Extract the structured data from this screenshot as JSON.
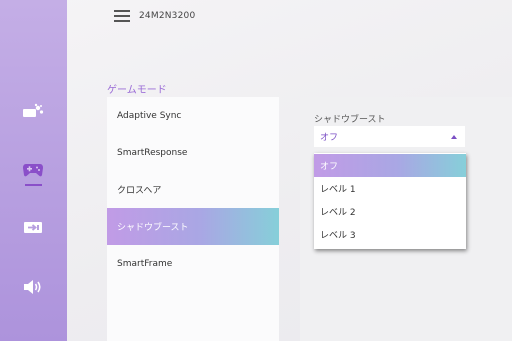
{
  "header": {
    "model_name": "24M2N3200"
  },
  "sidebar": {
    "icons": [
      {
        "name": "picture-icon"
      },
      {
        "name": "game-mode-icon",
        "active": true
      },
      {
        "name": "input-source-icon"
      },
      {
        "name": "volume-icon"
      }
    ]
  },
  "section": {
    "title": "ゲームモード"
  },
  "menu": {
    "items": [
      {
        "label": "Adaptive Sync",
        "selected": false
      },
      {
        "label": "SmartResponse",
        "selected": false
      },
      {
        "label": "クロスヘア",
        "selected": false
      },
      {
        "label": "シャドウブースト",
        "selected": true
      },
      {
        "label": "SmartFrame",
        "selected": false
      }
    ]
  },
  "shadow_boost": {
    "label": "シャドウブースト",
    "current_value": "オフ",
    "options": [
      "オフ",
      "レベル 1",
      "レベル 2",
      "レベル 3"
    ],
    "selected_index": 0
  },
  "colors": {
    "accent": "#8a4fc9",
    "sidebar_top": "#c4aee6",
    "highlight_start": "#c19be6",
    "highlight_end": "#86cfd9"
  }
}
